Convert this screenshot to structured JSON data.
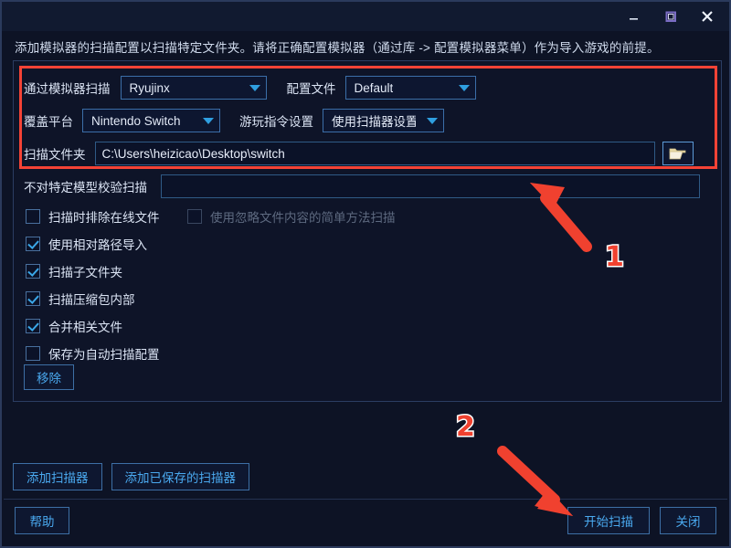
{
  "window": {
    "description": "添加模拟器的扫描配置以扫描特定文件夹。请将正确配置模拟器（通过库 -> 配置模拟器菜单）作为导入游戏的前提。",
    "controls": {
      "minimize": "minimize-icon",
      "maximize": "maximize-icon",
      "close": "close-icon"
    }
  },
  "form": {
    "scan_by_emulator_label": "通过模拟器扫描",
    "scan_by_emulator_value": "Ryujinx",
    "profile_label": "配置文件",
    "profile_value": "Default",
    "override_platform_label": "覆盖平台",
    "override_platform_value": "Nintendo Switch",
    "play_action_label": "游玩指令设置",
    "play_action_value": "使用扫描器设置",
    "scan_folder_label": "扫描文件夹",
    "scan_folder_value": "C:\\Users\\heizicao\\Desktop\\switch",
    "browse_icon": "folder-open-icon",
    "exclude_model_label": "不对特定模型校验扫描",
    "exclude_model_value": "",
    "exclude_model_placeholder": ""
  },
  "checkboxes": [
    {
      "label": "扫描时排除在线文件",
      "checked": false,
      "disabled": false
    },
    {
      "label": "使用忽略文件内容的简单方法扫描",
      "checked": false,
      "disabled": true
    },
    {
      "label": "使用相对路径导入",
      "checked": true,
      "disabled": false
    },
    {
      "label": "扫描子文件夹",
      "checked": true,
      "disabled": false
    },
    {
      "label": "扫描压缩包内部",
      "checked": true,
      "disabled": false
    },
    {
      "label": "合并相关文件",
      "checked": true,
      "disabled": false
    },
    {
      "label": "保存为自动扫描配置",
      "checked": false,
      "disabled": false
    }
  ],
  "buttons": {
    "remove": "移除",
    "add_scanner": "添加扫描器",
    "add_saved_scanner": "添加已保存的扫描器",
    "help": "帮助",
    "start_scan": "开始扫描",
    "close": "关闭"
  },
  "annotations": {
    "marker_1": "1",
    "marker_2": "2",
    "arrow_color": "#f0412f",
    "highlight_color": "#f44336"
  }
}
